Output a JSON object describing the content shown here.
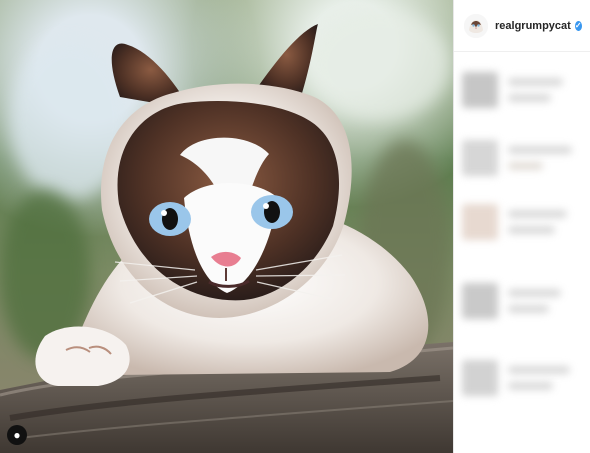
{
  "post": {
    "username": "realgrumpycat",
    "verified_mark": "✓",
    "profile_avatar": "grumpy-cat-avatar",
    "photo_subject": "grumpy-cat-photo"
  },
  "overlay": {
    "icon": "user-icon"
  },
  "sidebar": {
    "blurred_rows": [
      {
        "id": "comment-row-1"
      },
      {
        "id": "comment-row-2"
      },
      {
        "id": "comment-row-3"
      },
      {
        "id": "comment-row-4"
      },
      {
        "id": "comment-row-5"
      }
    ]
  }
}
